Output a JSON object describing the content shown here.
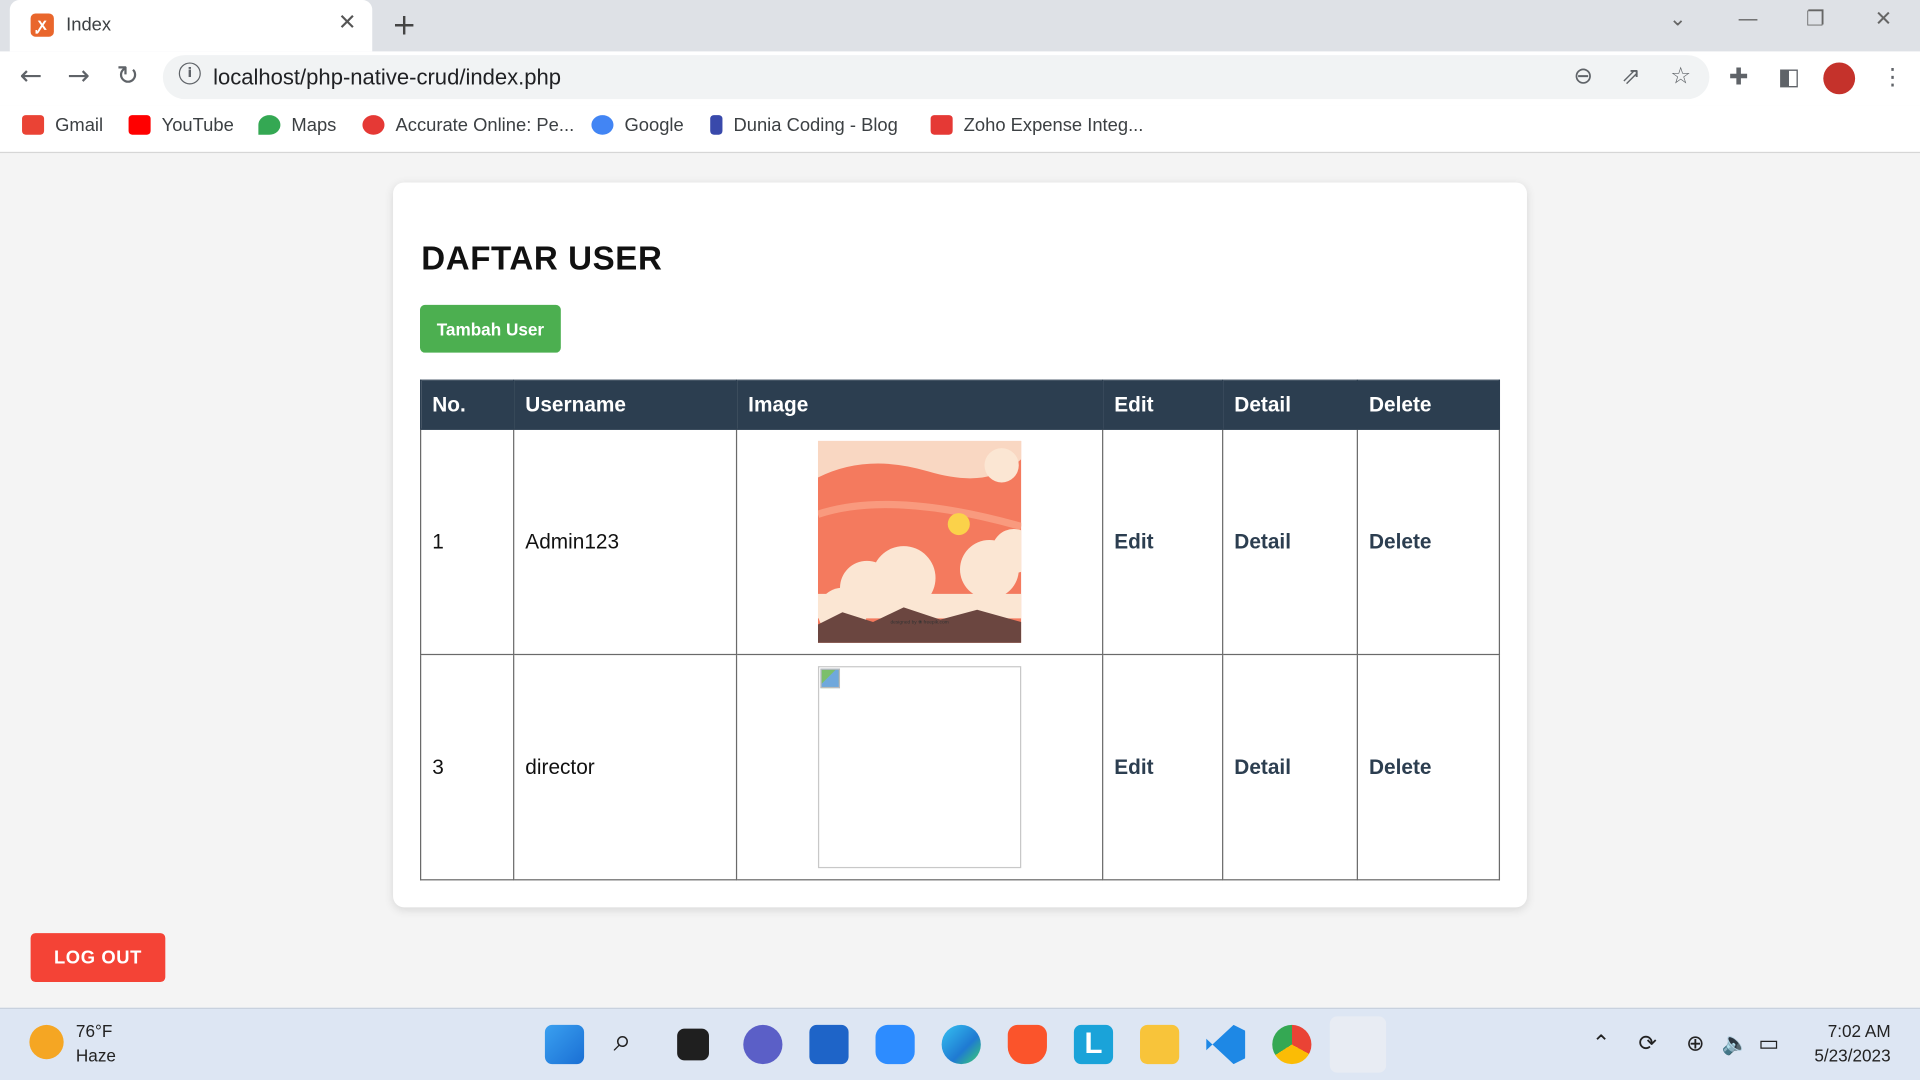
{
  "browser": {
    "tab_title": "Index",
    "tab_favicon": "xampp-icon",
    "url": "localhost/php-native-crud/index.php",
    "bookmarks": [
      {
        "label": "Gmail",
        "icon": "gmail-icon",
        "color": "#ea4335"
      },
      {
        "label": "YouTube",
        "icon": "youtube-icon",
        "color": "#ff0000"
      },
      {
        "label": "Maps",
        "icon": "maps-icon",
        "color": "#34a853"
      },
      {
        "label": "Accurate Online: Pe...",
        "icon": "accurate-icon",
        "color": "#e53935"
      },
      {
        "label": "Google",
        "icon": "google-icon",
        "color": "#4285f4"
      },
      {
        "label": "Dunia Coding - Blog",
        "icon": "duniacoding-icon",
        "color": "#3949ab"
      },
      {
        "label": "Zoho Expense Integ...",
        "icon": "zoho-icon",
        "color": "#e53935"
      }
    ]
  },
  "page": {
    "heading": "DAFTAR USER",
    "add_button": "Tambah User",
    "logout_button": "LOG OUT",
    "table": {
      "headers": [
        "No.",
        "Username",
        "Image",
        "Edit",
        "Detail",
        "Delete"
      ],
      "rows": [
        {
          "no": "1",
          "username": "Admin123",
          "image": "sky-clouds-illustration",
          "edit": "Edit",
          "detail": "Detail",
          "delete": "Delete"
        },
        {
          "no": "3",
          "username": "director",
          "image": "broken-image",
          "edit": "Edit",
          "detail": "Detail",
          "delete": "Delete"
        }
      ]
    },
    "colors": {
      "header_bg": "#2c3e50",
      "add_button": "#4caf50",
      "logout_button": "#f44336"
    }
  },
  "taskbar": {
    "weather_temp": "76°F",
    "weather_condition": "Haze",
    "time": "7:02 AM",
    "date": "5/23/2023",
    "apps": [
      "windows-start-icon",
      "search-icon",
      "task-view-icon",
      "chat-icon",
      "store-icon",
      "zoom-icon",
      "edge-icon",
      "brave-icon",
      "l-app-icon",
      "file-explorer-icon",
      "vscode-icon",
      "chrome-icon",
      "snipping-tool-icon"
    ]
  }
}
